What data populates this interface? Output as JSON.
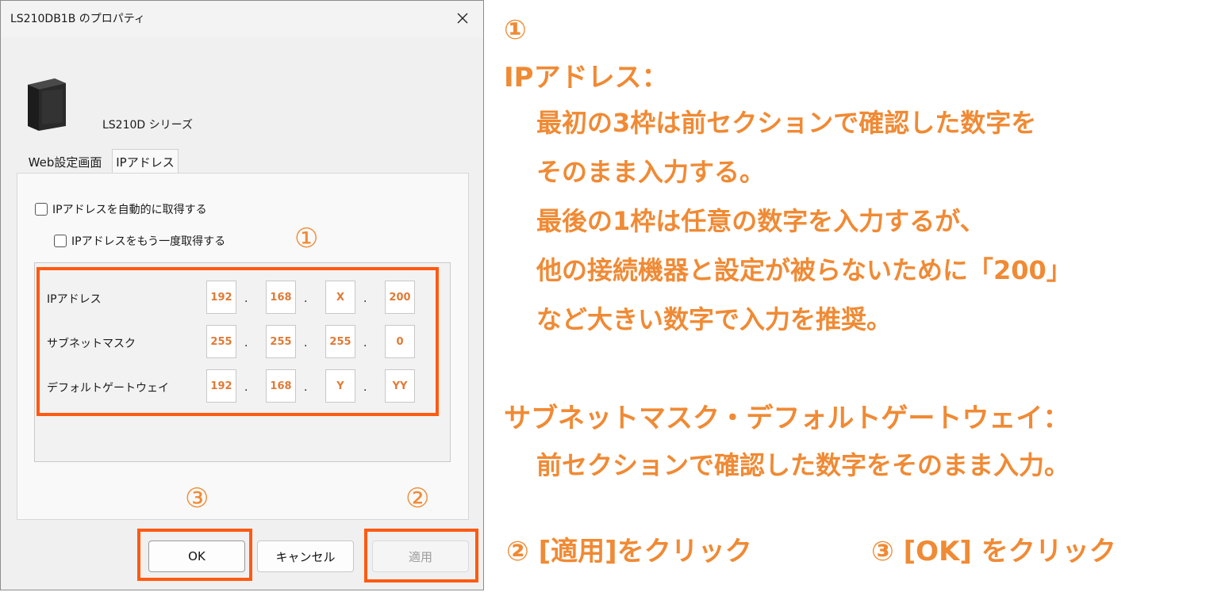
{
  "dialog": {
    "title": "LS210DB1B のプロパティ",
    "device_name": "LS210D シリーズ",
    "tabs": [
      {
        "label": "Web設定画面"
      },
      {
        "label": "IPアドレス"
      }
    ],
    "checkboxes": [
      {
        "label": "IPアドレスを自動的に取得する",
        "checked": false
      },
      {
        "label": "IPアドレスをもう一度取得する",
        "checked": false
      }
    ],
    "fields": [
      {
        "label": "IPアドレス",
        "octets": [
          "192",
          "168",
          "X",
          "200"
        ]
      },
      {
        "label": "サブネットマスク",
        "octets": [
          "255",
          "255",
          "255",
          "0"
        ]
      },
      {
        "label": "デフォルトゲートウェイ",
        "octets": [
          "192",
          "168",
          "Y",
          "YY"
        ]
      }
    ],
    "separator": ".",
    "buttons": {
      "ok": "OK",
      "cancel": "キャンセル",
      "apply": "適用"
    },
    "markers": {
      "one": "①",
      "two": "②",
      "three": "③"
    }
  },
  "annotation": {
    "marker": "①",
    "ip_heading": "IPアドレス：",
    "ip_lines": [
      "最初の3枠は前セクションで確認した数字を",
      "そのまま入力する。",
      "最後の1枠は任意の数字を入力するが、",
      "他の接続機器と設定が被らないために「200」",
      "など大きい数字で入力を推奨。"
    ],
    "subnet_heading": "サブネットマスク・デフォルトゲートウェイ：",
    "subnet_line": "前セクションで確認した数字をそのまま入力。",
    "step2": "② [適用]をクリック",
    "step3": "③ [OK] をクリック"
  },
  "colors": {
    "accent_orange": "#f08a34",
    "highlight_border": "#ff5a12",
    "dialog_bg": "#f0f0f0"
  }
}
